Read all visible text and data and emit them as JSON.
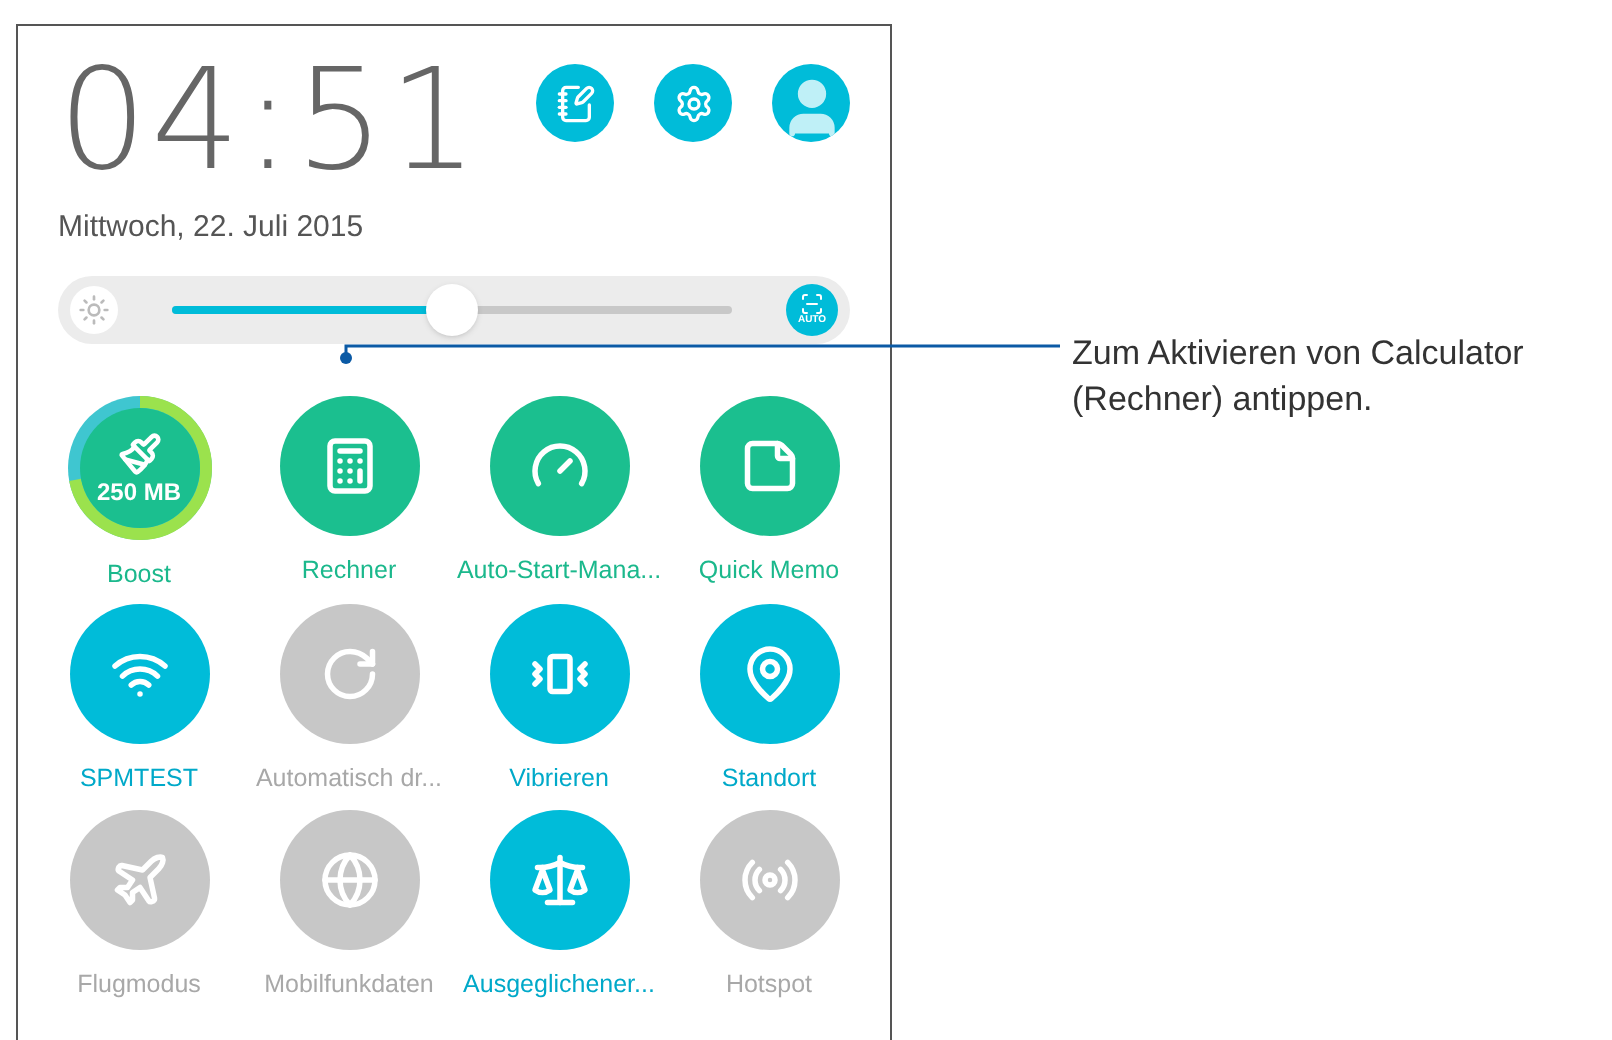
{
  "clock": {
    "time": "04:51",
    "date": "Mittwoch, 22. Juli 2015"
  },
  "brightness": {
    "level": 0.5,
    "auto_label": "AUTO"
  },
  "tiles": [
    {
      "kind": "boost",
      "label": "Boost",
      "value": "250 MB",
      "level": 0.72
    },
    {
      "kind": "app",
      "label": "Rechner"
    },
    {
      "kind": "app",
      "label": "Auto-Start-Mana..."
    },
    {
      "kind": "app",
      "label": "Quick Memo"
    },
    {
      "kind": "toggle",
      "label": "SPMTEST",
      "on": true
    },
    {
      "kind": "toggle",
      "label": "Automatisch dr...",
      "on": false
    },
    {
      "kind": "toggle",
      "label": "Vibrieren",
      "on": true
    },
    {
      "kind": "toggle",
      "label": "Standort",
      "on": true
    },
    {
      "kind": "toggle",
      "label": "Flugmodus",
      "on": false
    },
    {
      "kind": "toggle",
      "label": "Mobilfunkdaten",
      "on": false
    },
    {
      "kind": "toggle",
      "label": "Ausgeglichener...",
      "on": true
    },
    {
      "kind": "toggle",
      "label": "Hotspot",
      "on": false
    }
  ],
  "callout": {
    "text": "Zum Aktivieren von Calculator (Rechner) antippen."
  }
}
